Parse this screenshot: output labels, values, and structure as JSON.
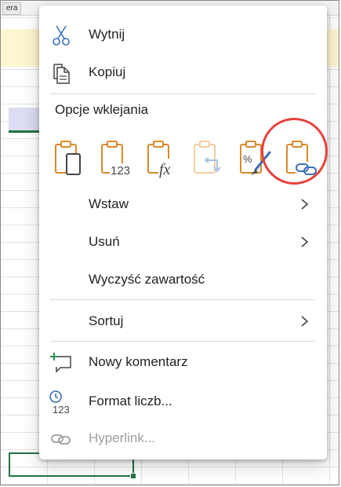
{
  "spreadsheet": {
    "sheet_tab_label": "era"
  },
  "context_menu": {
    "items_top": [
      {
        "label": "Wytnij",
        "icon": "scissors-icon"
      },
      {
        "label": "Kopiuj",
        "icon": "copy-icon"
      }
    ],
    "paste_options": {
      "heading": "Opcje wklejania",
      "options": [
        {
          "name": "paste-icon"
        },
        {
          "name": "paste-values-icon",
          "badge": "123"
        },
        {
          "name": "paste-formulas-icon",
          "badge": "fx"
        },
        {
          "name": "paste-transpose-icon",
          "disabled": true
        },
        {
          "name": "paste-formatting-icon"
        },
        {
          "name": "paste-link-icon",
          "highlighted": true
        }
      ]
    },
    "items_middle": [
      {
        "label": "Wstaw",
        "has_submenu": true
      },
      {
        "label": "Usuń",
        "has_submenu": true
      },
      {
        "label": "Wyczyść zawartość",
        "has_submenu": false
      },
      {
        "label": "Sortuj",
        "has_submenu": true
      }
    ],
    "items_bottom": [
      {
        "label": "Nowy komentarz",
        "icon": "new-comment-icon"
      },
      {
        "label": "Format liczb...",
        "icon": "number-format-icon",
        "icon_text": "123"
      },
      {
        "label": "Hyperlink...",
        "icon": "hyperlink-icon",
        "disabled": true
      }
    ]
  },
  "colors": {
    "accent_orange": "#d98a2c",
    "accent_blue": "#3c6fb8",
    "highlight_red": "#e8413c",
    "excel_green": "#217346"
  }
}
